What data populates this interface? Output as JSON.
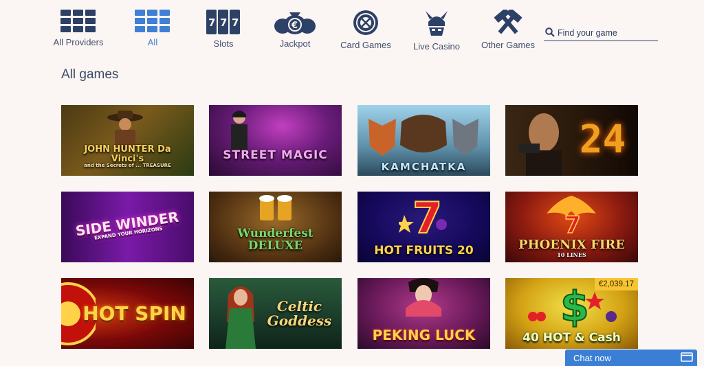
{
  "nav": {
    "categories": [
      {
        "label": "All Providers",
        "icon": "grid-icon",
        "active": false
      },
      {
        "label": "All",
        "icon": "grid-icon",
        "active": true
      },
      {
        "label": "Slots",
        "icon": "slots-777-icon",
        "active": false
      },
      {
        "label": "Jackpot",
        "icon": "money-bag-euro-icon",
        "active": false
      },
      {
        "label": "Card Games",
        "icon": "roulette-wheel-icon",
        "active": false
      },
      {
        "label": "Live Casino",
        "icon": "viking-helmet-icon",
        "active": false
      },
      {
        "label": "Other Games",
        "icon": "crossed-hammers-icon",
        "active": false
      }
    ],
    "search": {
      "placeholder": "Find your game",
      "icon": "search-icon"
    }
  },
  "main": {
    "heading": "All games",
    "games": [
      {
        "title": "JOHN HUNTER Da Vinci's",
        "subtitle": "and the Secrets of ... TREASURE"
      },
      {
        "title": "STREET MAGIC",
        "subtitle": ""
      },
      {
        "title": "KAMCHATKA",
        "subtitle": ""
      },
      {
        "title": "24",
        "subtitle": ""
      },
      {
        "title": "SIDE WINDER",
        "subtitle": "EXPAND YOUR HORIZONS"
      },
      {
        "title": "Wunderfest DELUXE",
        "subtitle": ""
      },
      {
        "title": "HOT FRUITS 20",
        "subtitle": ""
      },
      {
        "title": "PHOENIX FIRE",
        "subtitle": "10 LINES"
      },
      {
        "title": "HOT SPIN",
        "subtitle": ""
      },
      {
        "title": "Celtic Goddess",
        "subtitle": ""
      },
      {
        "title": "PEKING LUCK",
        "subtitle": ""
      },
      {
        "title": "40 HOT & Cash",
        "subtitle": "",
        "jackpot": "€2,039.17"
      }
    ]
  },
  "chat": {
    "label": "Chat now",
    "icon": "window-icon"
  },
  "colors": {
    "background": "#fbf5f3",
    "nav_icon": "#2d4166",
    "active": "#3f7fd6",
    "chat": "#3a7fd5",
    "jackpot_badge": "#f7c531"
  }
}
